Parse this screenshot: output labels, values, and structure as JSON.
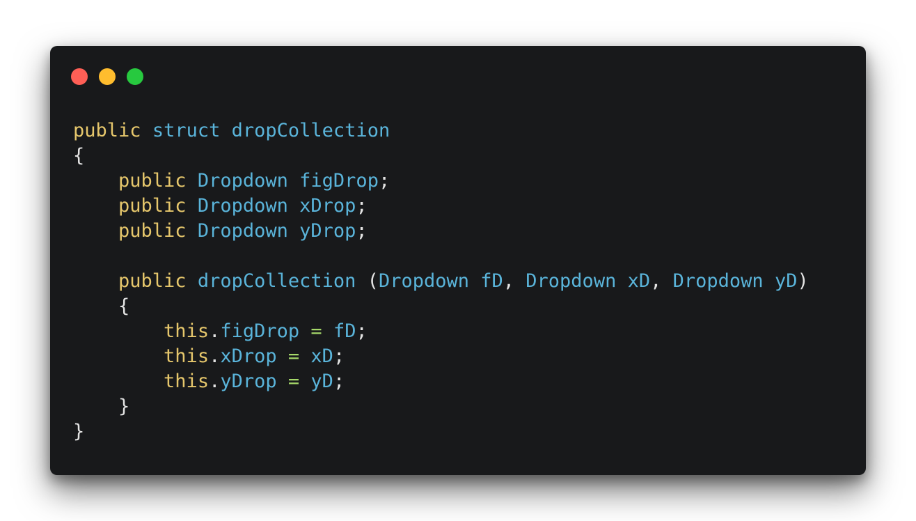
{
  "window": {
    "controls": [
      {
        "name": "close-dot",
        "color": "#ff5f56"
      },
      {
        "name": "minimize-dot",
        "color": "#ffbd2e"
      },
      {
        "name": "zoom-dot",
        "color": "#27c93f"
      }
    ]
  },
  "colors": {
    "background": "#18191b",
    "keyword": "#e6c76c",
    "type": "#5ab4da",
    "identifier": "#5ab4da",
    "operator": "#a6d96a",
    "punctuation": "#e4e4e4"
  },
  "code": {
    "language": "csharp",
    "lines": [
      [
        {
          "t": "public",
          "k": "kw"
        },
        {
          "t": " ",
          "k": "pn"
        },
        {
          "t": "struct",
          "k": "ty"
        },
        {
          "t": " ",
          "k": "pn"
        },
        {
          "t": "dropCollection",
          "k": "id"
        }
      ],
      [
        {
          "t": "{",
          "k": "pn"
        }
      ],
      [
        {
          "t": "    ",
          "k": "pn"
        },
        {
          "t": "public",
          "k": "kw"
        },
        {
          "t": " ",
          "k": "pn"
        },
        {
          "t": "Dropdown",
          "k": "ty"
        },
        {
          "t": " ",
          "k": "pn"
        },
        {
          "t": "figDrop",
          "k": "id"
        },
        {
          "t": ";",
          "k": "pn"
        }
      ],
      [
        {
          "t": "    ",
          "k": "pn"
        },
        {
          "t": "public",
          "k": "kw"
        },
        {
          "t": " ",
          "k": "pn"
        },
        {
          "t": "Dropdown",
          "k": "ty"
        },
        {
          "t": " ",
          "k": "pn"
        },
        {
          "t": "xDrop",
          "k": "id"
        },
        {
          "t": ";",
          "k": "pn"
        }
      ],
      [
        {
          "t": "    ",
          "k": "pn"
        },
        {
          "t": "public",
          "k": "kw"
        },
        {
          "t": " ",
          "k": "pn"
        },
        {
          "t": "Dropdown",
          "k": "ty"
        },
        {
          "t": " ",
          "k": "pn"
        },
        {
          "t": "yDrop",
          "k": "id"
        },
        {
          "t": ";",
          "k": "pn"
        }
      ],
      [],
      [
        {
          "t": "    ",
          "k": "pn"
        },
        {
          "t": "public",
          "k": "kw"
        },
        {
          "t": " ",
          "k": "pn"
        },
        {
          "t": "dropCollection",
          "k": "id"
        },
        {
          "t": " (",
          "k": "pn"
        },
        {
          "t": "Dropdown",
          "k": "ty"
        },
        {
          "t": " ",
          "k": "pn"
        },
        {
          "t": "fD",
          "k": "id"
        },
        {
          "t": ", ",
          "k": "pn"
        },
        {
          "t": "Dropdown",
          "k": "ty"
        },
        {
          "t": " ",
          "k": "pn"
        },
        {
          "t": "xD",
          "k": "id"
        },
        {
          "t": ", ",
          "k": "pn"
        },
        {
          "t": "Dropdown",
          "k": "ty"
        },
        {
          "t": " ",
          "k": "pn"
        },
        {
          "t": "yD",
          "k": "id"
        },
        {
          "t": ")",
          "k": "pn"
        }
      ],
      [
        {
          "t": "    ",
          "k": "pn"
        },
        {
          "t": "{",
          "k": "pn"
        }
      ],
      [
        {
          "t": "        ",
          "k": "pn"
        },
        {
          "t": "this",
          "k": "kw"
        },
        {
          "t": ".",
          "k": "pn"
        },
        {
          "t": "figDrop",
          "k": "id"
        },
        {
          "t": " ",
          "k": "pn"
        },
        {
          "t": "=",
          "k": "op"
        },
        {
          "t": " ",
          "k": "pn"
        },
        {
          "t": "fD",
          "k": "id"
        },
        {
          "t": ";",
          "k": "pn"
        }
      ],
      [
        {
          "t": "        ",
          "k": "pn"
        },
        {
          "t": "this",
          "k": "kw"
        },
        {
          "t": ".",
          "k": "pn"
        },
        {
          "t": "xDrop",
          "k": "id"
        },
        {
          "t": " ",
          "k": "pn"
        },
        {
          "t": "=",
          "k": "op"
        },
        {
          "t": " ",
          "k": "pn"
        },
        {
          "t": "xD",
          "k": "id"
        },
        {
          "t": ";",
          "k": "pn"
        }
      ],
      [
        {
          "t": "        ",
          "k": "pn"
        },
        {
          "t": "this",
          "k": "kw"
        },
        {
          "t": ".",
          "k": "pn"
        },
        {
          "t": "yDrop",
          "k": "id"
        },
        {
          "t": " ",
          "k": "pn"
        },
        {
          "t": "=",
          "k": "op"
        },
        {
          "t": " ",
          "k": "pn"
        },
        {
          "t": "yD",
          "k": "id"
        },
        {
          "t": ";",
          "k": "pn"
        }
      ],
      [
        {
          "t": "    ",
          "k": "pn"
        },
        {
          "t": "}",
          "k": "pn"
        }
      ],
      [
        {
          "t": "}",
          "k": "pn"
        }
      ]
    ]
  }
}
